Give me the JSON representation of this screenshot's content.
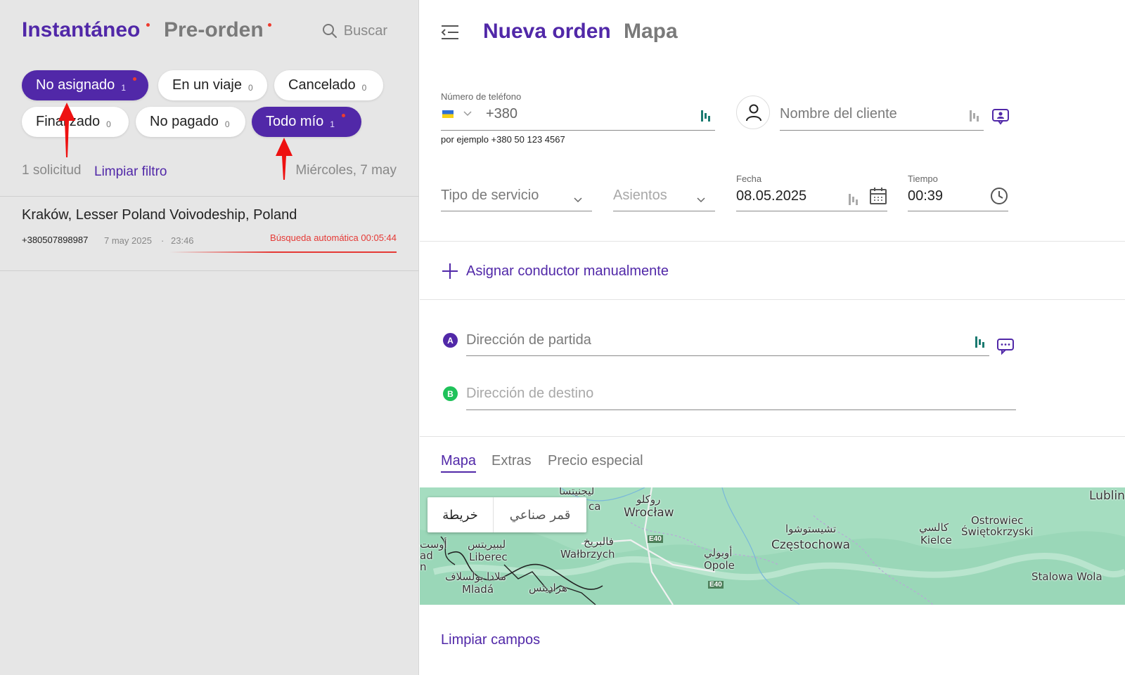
{
  "left_panel": {
    "tabs": [
      {
        "label": "Instantáneo",
        "active": true,
        "has_dot": true
      },
      {
        "label": "Pre-orden",
        "active": false,
        "has_dot": true
      }
    ],
    "search_label": "Buscar",
    "search_icon": "search-icon",
    "filters": [
      {
        "label": "No asignado",
        "count": "1",
        "selected": true,
        "has_dot": true
      },
      {
        "label": "En un viaje",
        "count": "0",
        "selected": false
      },
      {
        "label": "Cancelado",
        "count": "0",
        "selected": false
      },
      {
        "label": "Finalizado",
        "count": "0",
        "selected": false
      },
      {
        "label": "No pagado",
        "count": "0",
        "selected": false
      },
      {
        "label": "Todo mío",
        "count": "1",
        "selected": true,
        "has_dot": true
      }
    ],
    "request_count": "1 solicitud",
    "clear_filter": "Limpiar filtro",
    "date": "Miércoles, 7 may",
    "orders": [
      {
        "address": "Kraków, Lesser Poland Voivodeship, Poland",
        "phone": "+380507898987",
        "date": "7 may 2025",
        "separator": "·",
        "time": "23:46",
        "status": "Búsqueda automática 00:05:44"
      }
    ]
  },
  "right_panel": {
    "menu_icon": "menu-collapse-icon",
    "tabs": [
      {
        "label": "Nueva orden",
        "active": true
      },
      {
        "label": "Mapa",
        "active": false
      }
    ],
    "phone": {
      "label": "Número de teléfono",
      "country_flag": "ukraine-flag-icon",
      "value": "+380",
      "hint": "por ejemplo +380 50 123 4567"
    },
    "client_name": {
      "placeholder": "Nombre del cliente"
    },
    "service_type": {
      "placeholder": "Tipo de servicio"
    },
    "seats": {
      "placeholder": "Asientos"
    },
    "date": {
      "label": "Fecha",
      "value": "08.05.2025"
    },
    "time": {
      "label": "Tiempo",
      "value": "00:39"
    },
    "assign_driver": "Asignar conductor manualmente",
    "pickup": {
      "badge": "A",
      "placeholder": "Dirección de partida"
    },
    "destination": {
      "badge": "B",
      "placeholder": "Dirección de destino"
    },
    "bottom_tabs": [
      {
        "label": "Mapa",
        "active": true
      },
      {
        "label": "Extras",
        "active": false
      },
      {
        "label": "Precio especial",
        "active": false
      }
    ],
    "map": {
      "type_map": "خريطة",
      "type_satellite": "قمر صناعي",
      "cities": {
        "wroclaw_ar": "روكلو",
        "wroclaw": "Wrocław",
        "walbrzych_ar": "فالبريخ",
        "walbrzych": "Wałbrzych",
        "liberec_ar": "ليبيريتس",
        "liberec": "Liberec",
        "mlada_ar": "ملادا بولسلاف",
        "mlada": "Mladá",
        "hradec_ar": "هراديتس",
        "legnica_ar": "ليجنيتسا",
        "legnica": "ca",
        "opole_ar": "أوبولي",
        "opole": "Opole",
        "czestochowa_ar": "تشيستوشوا",
        "czestochowa": "Częstochowa",
        "kielce_ar": "كالسي",
        "kielce": "Kielce",
        "ostrowiec": "Ostrowiec",
        "swietokrzyski": "Świętokrzyski",
        "stalowa": "Stalowa Wola",
        "lublin": "Lublin",
        "edge_ar": "أوست",
        "edge_ad": "ad",
        "edge_n": "n"
      },
      "roads": [
        "E40",
        "E40"
      ]
    },
    "clear_fields": "Limpiar campos"
  },
  "colors": {
    "accent": "#5128a8",
    "alert": "#e53935",
    "badge_b": "#1fc25a",
    "map_green": "#a5ddc0"
  }
}
